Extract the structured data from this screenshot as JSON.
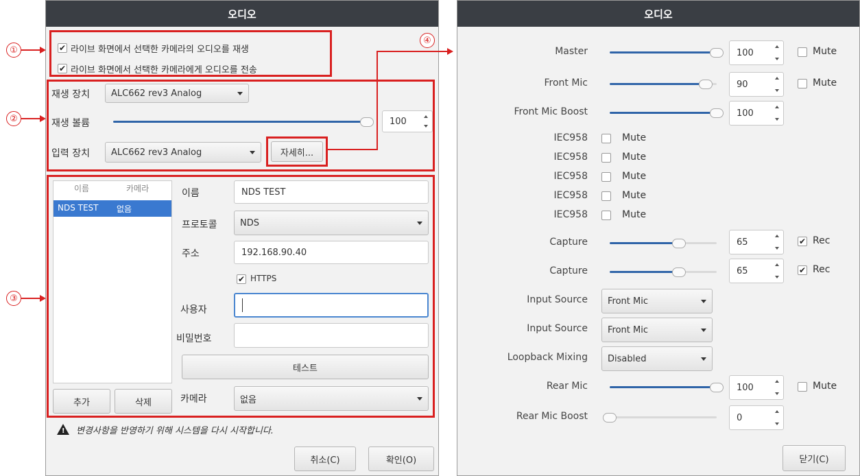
{
  "left_dialog": {
    "title": "오디오",
    "options": {
      "play_audio": {
        "label": "라이브 화면에서 선택한 카메라의 오디오를 재생",
        "checked": true
      },
      "send_audio": {
        "label": "라이브 화면에서 선택한 카메라에게 오디오를 전송",
        "checked": true
      }
    },
    "playback_device": {
      "label": "재생 장치",
      "value": "ALC662 rev3 Analog"
    },
    "playback_volume": {
      "label": "재생 볼륨",
      "value": "100",
      "level": 1.0
    },
    "input_device": {
      "label": "입력 장치",
      "value": "ALC662 rev3 Analog"
    },
    "details_button": "자세히...",
    "camera_list": {
      "headers": [
        "이름",
        "카메라"
      ],
      "rows": [
        {
          "name": "NDS TEST",
          "camera": "없음",
          "selected": true
        }
      ],
      "add_button": "추가",
      "delete_button": "삭제"
    },
    "form": {
      "name_label": "이름",
      "name_value": "NDS TEST",
      "protocol_label": "프로토콜",
      "protocol_value": "NDS",
      "address_label": "주소",
      "address_value": "192.168.90.40",
      "https_label": "HTTPS",
      "https_checked": true,
      "user_label": "사용자",
      "user_value": "",
      "password_label": "비밀번호",
      "password_value": "",
      "test_button": "테스트",
      "camera_label": "카메라",
      "camera_value": "없음"
    },
    "warning": "변경사항을 반영하기 위해 시스템을 다시 시작합니다.",
    "cancel_button": "취소(C)",
    "ok_button": "확인(O)"
  },
  "callouts": [
    "①",
    "②",
    "③",
    "④"
  ],
  "right_dialog": {
    "title": "오디오",
    "mute_label": "Mute",
    "rec_label": "Rec",
    "rows": {
      "master": {
        "label": "Master",
        "value": "100",
        "level": 1.0
      },
      "front_mic": {
        "label": "Front Mic",
        "value": "90",
        "level": 0.9
      },
      "front_mic_boost": {
        "label": "Front Mic Boost",
        "value": "100",
        "level": 1.0
      },
      "iec958": [
        "IEC958",
        "IEC958",
        "IEC958",
        "IEC958",
        "IEC958"
      ],
      "capture1": {
        "label": "Capture",
        "value": "65",
        "level": 0.65,
        "rec": true
      },
      "capture2": {
        "label": "Capture",
        "value": "65",
        "level": 0.65,
        "rec": true
      },
      "input_source1": {
        "label": "Input Source",
        "value": "Front Mic"
      },
      "input_source2": {
        "label": "Input Source",
        "value": "Front Mic"
      },
      "loopback": {
        "label": "Loopback Mixing",
        "value": "Disabled"
      },
      "rear_mic": {
        "label": "Rear Mic",
        "value": "100",
        "level": 1.0
      },
      "rear_mic_boost": {
        "label": "Rear Mic Boost",
        "value": "0",
        "level": 0.0
      }
    },
    "close_button": "닫기(C)"
  },
  "colors": {
    "title_bg": "#3a3e44",
    "accent": "#2f64a8",
    "callout": "#d92020",
    "selection": "#3a79d0"
  }
}
